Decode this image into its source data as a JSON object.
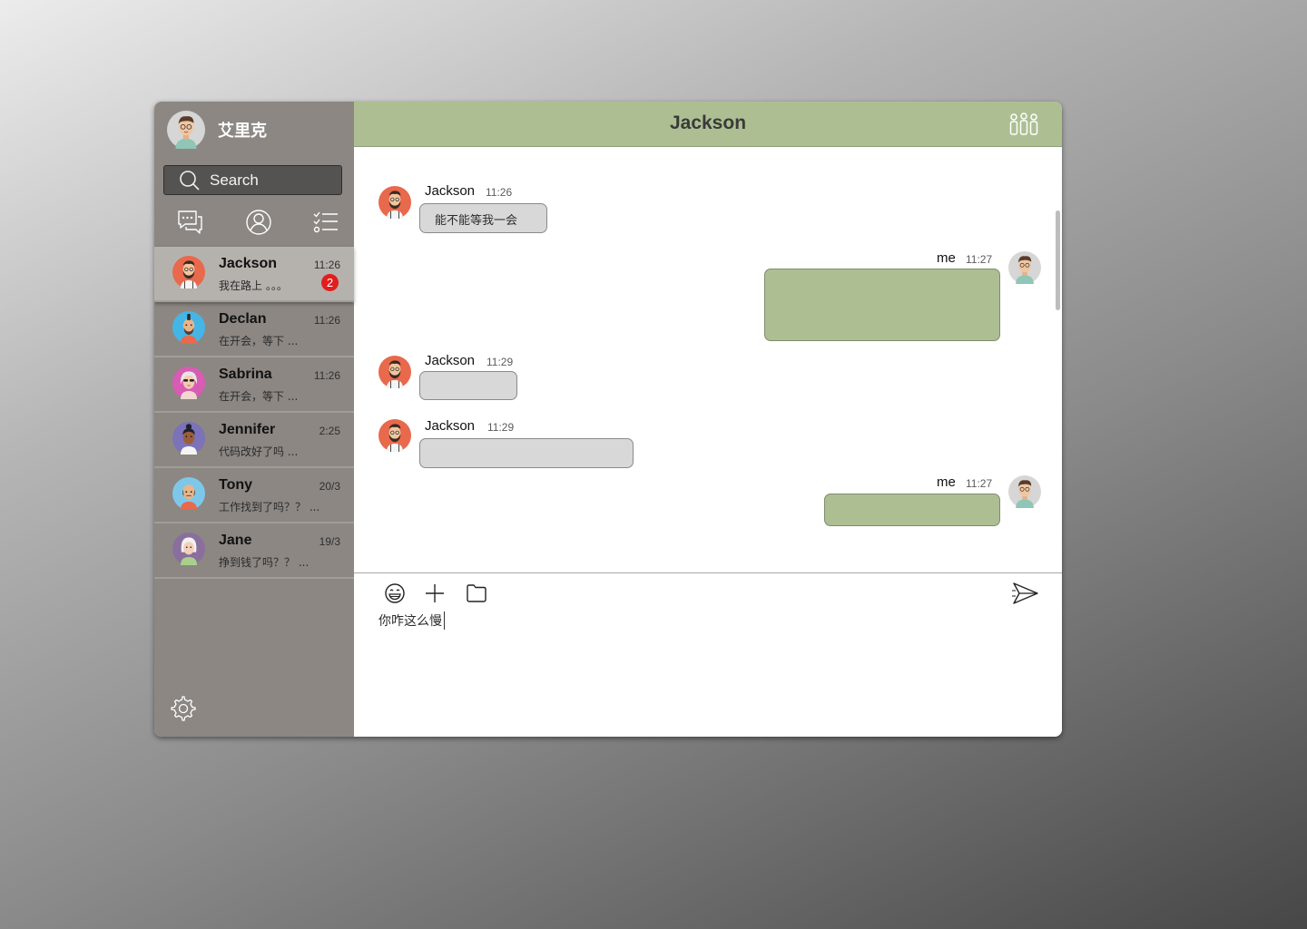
{
  "user": {
    "name": "艾里克",
    "avatar_icon": "man-glasses-avatar-icon"
  },
  "search": {
    "placeholder": "Search"
  },
  "nav_icons": [
    "chat-bubbles-icon",
    "contacts-icon",
    "task-list-icon"
  ],
  "chats": [
    {
      "name": "Jackson",
      "preview": "我在路上 。。。",
      "time": "11:26",
      "unread": "2",
      "active": true,
      "avatar": "bearded-man-avatar-icon"
    },
    {
      "name": "Declan",
      "preview": "在开会，等下 ...",
      "time": "11:26",
      "avatar": "mohawk-man-avatar-icon"
    },
    {
      "name": "Sabrina",
      "preview": "在开会，等下 ...",
      "time": "11:26",
      "avatar": "sunglasses-woman-avatar-icon"
    },
    {
      "name": "Jennifer",
      "preview": "代码改好了吗  ...",
      "time": "2:25",
      "avatar": "woman-bun-avatar-icon"
    },
    {
      "name": "Tony",
      "preview": "工作找到了吗？？  ...",
      "time": "20/3",
      "avatar": "bald-man-avatar-icon"
    },
    {
      "name": "Jane",
      "preview": "挣到钱了吗？？  ...",
      "time": "19/3",
      "avatar": "elderly-woman-avatar-icon"
    }
  ],
  "conversation": {
    "title": "Jackson",
    "messages": [
      {
        "sender": "Jackson",
        "time": "11:26",
        "text": "能不能等我一会",
        "direction": "in"
      },
      {
        "sender": "me",
        "time": "11:27",
        "text": "",
        "direction": "out"
      },
      {
        "sender": "Jackson",
        "time": "11:29",
        "text": "",
        "direction": "in"
      },
      {
        "sender": "Jackson",
        "time": "11:29",
        "text": "",
        "direction": "in"
      },
      {
        "sender": "me",
        "time": "11:27",
        "text": "",
        "direction": "out"
      }
    ]
  },
  "composer": {
    "text": "你咋这么慢"
  },
  "colors": {
    "sidebar": "#8c8783",
    "header": "#adbf92",
    "outgoing_bubble": "#adbf92",
    "incoming_bubble": "#d8d8d8",
    "badge": "#e11d1d"
  }
}
